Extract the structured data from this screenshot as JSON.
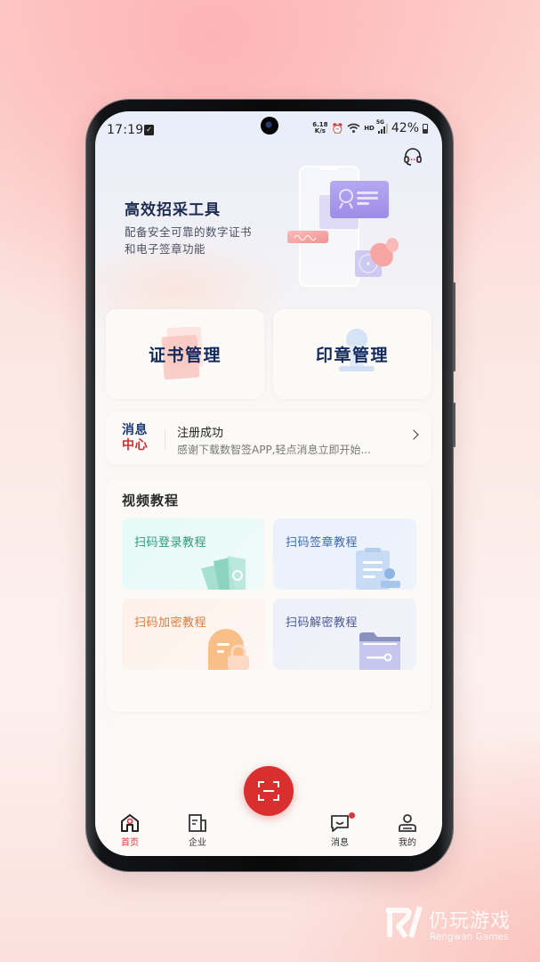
{
  "status_bar": {
    "time": "17:19",
    "net_speed_value": "6.18",
    "net_speed_unit": "K/s",
    "hd_label": "HD",
    "network_label": "5G",
    "battery": "42%"
  },
  "hero": {
    "title": "高效招采工具",
    "subtitle_line1": "配备安全可靠的数字证书",
    "subtitle_line2": "和电子签章功能"
  },
  "management": [
    {
      "label": "证书管理"
    },
    {
      "label": "印章管理"
    }
  ],
  "message_center": {
    "logo_line1": "消息",
    "logo_line2": "中心",
    "title": "注册成功",
    "preview": "感谢下载数智签APP,轻点消息立即开始..."
  },
  "video_tutorials": {
    "heading": "视频教程",
    "items": [
      {
        "label": "扫码登录教程",
        "color": "#2e9a7e"
      },
      {
        "label": "扫码签章教程",
        "color": "#3c6bb4"
      },
      {
        "label": "扫码加密教程",
        "color": "#e07a3c"
      },
      {
        "label": "扫码解密教程",
        "color": "#4a5a95"
      }
    ]
  },
  "bottom_nav": {
    "items": [
      {
        "label": "首页",
        "active": true
      },
      {
        "label": "企业",
        "active": false
      },
      {
        "label": "消息",
        "active": false,
        "has_badge": true
      },
      {
        "label": "我的",
        "active": false
      }
    ],
    "scan_button": "scan-icon"
  },
  "colors": {
    "accent_red": "#d9302f",
    "navy": "#142a5c"
  },
  "watermark": {
    "cn": "仍玩游戏",
    "en": "Rengwan Games"
  }
}
